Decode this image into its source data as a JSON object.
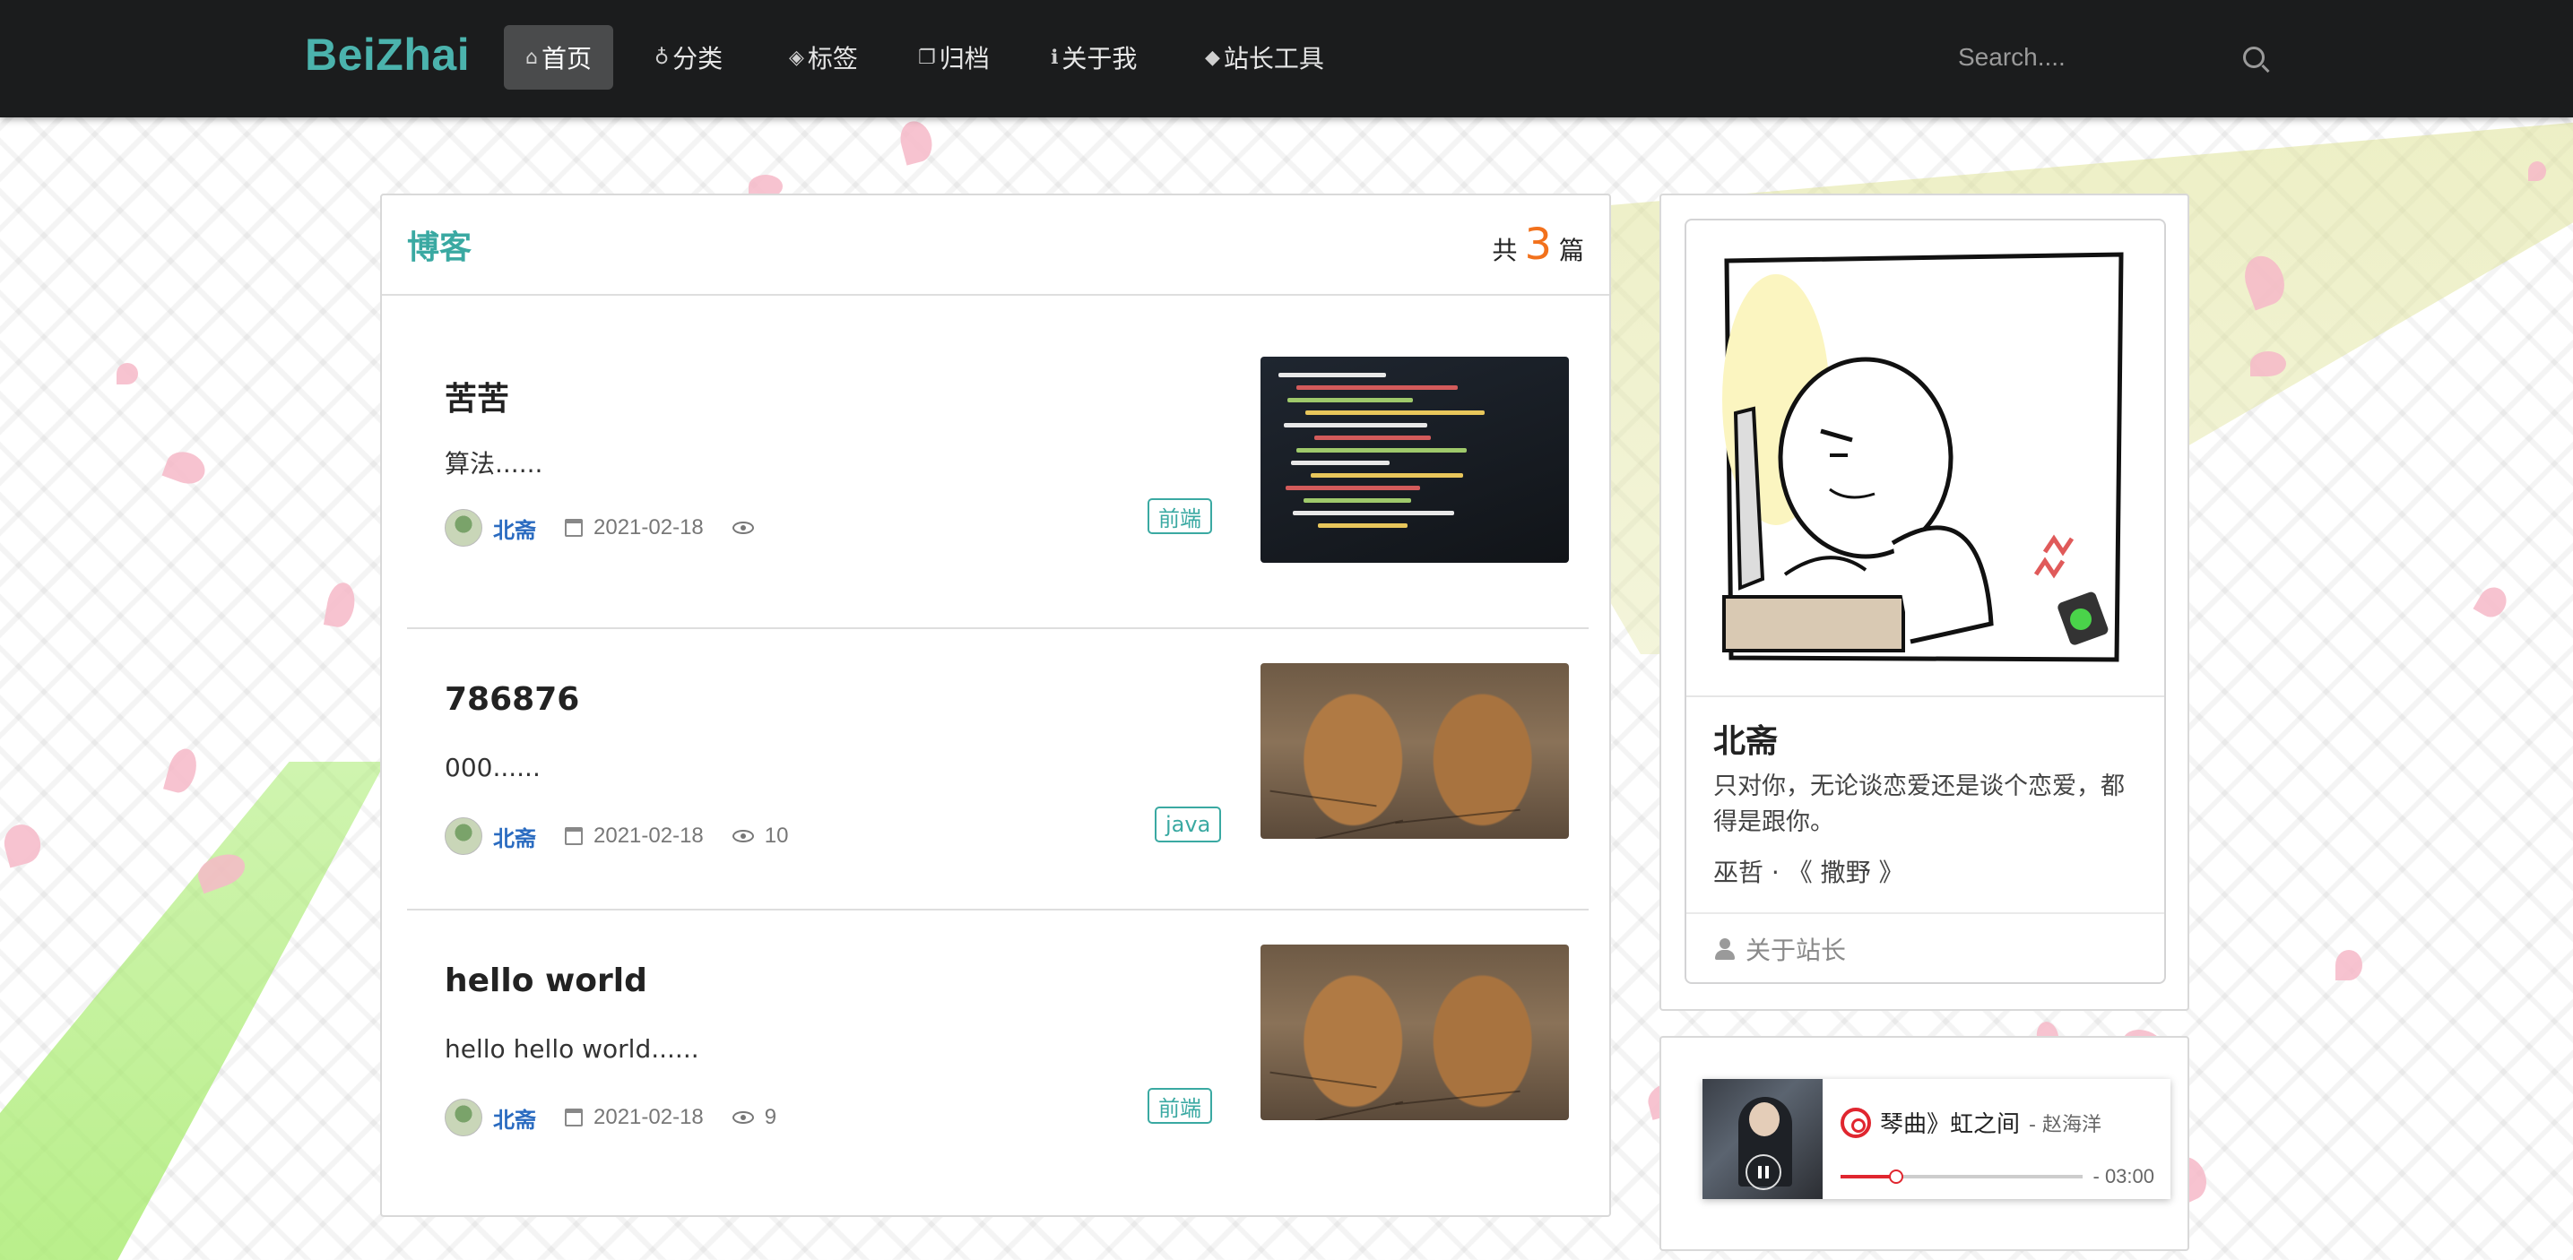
{
  "header": {
    "brand": "BeiZhai",
    "nav": [
      {
        "label": "首页",
        "icon": "home-icon",
        "active": true
      },
      {
        "label": "分类",
        "icon": "lightbulb-icon",
        "active": false
      },
      {
        "label": "标签",
        "icon": "tags-icon",
        "active": false
      },
      {
        "label": "归档",
        "icon": "clone-icon",
        "active": false
      },
      {
        "label": "关于我",
        "icon": "info-icon",
        "active": false
      },
      {
        "label": "站长工具",
        "icon": "tag-icon",
        "active": false
      }
    ],
    "search_placeholder": "Search...."
  },
  "blog": {
    "title": "博客",
    "count_prefix": "共",
    "count": "3",
    "count_suffix": "篇",
    "posts": [
      {
        "title": "苦苦",
        "excerpt": "算法......",
        "author": "北斋",
        "date": "2021-02-18",
        "views": "",
        "tag": "前端",
        "image": "code-screen"
      },
      {
        "title": "786876",
        "excerpt": "000......",
        "author": "北斋",
        "date": "2021-02-18",
        "views": "10",
        "tag": "java",
        "image": "giant-feet"
      },
      {
        "title": "hello world",
        "excerpt": "hello hello world......",
        "author": "北斋",
        "date": "2021-02-18",
        "views": "9",
        "tag": "前端",
        "image": "giant-feet"
      }
    ]
  },
  "profile": {
    "name": "北斋",
    "description": "只对你，无论谈恋爱还是谈个恋爱，都得是跟你。",
    "quote": "巫哲 · 《 撒野 》",
    "about_link": "关于站长"
  },
  "player": {
    "song": "琴曲》虹之间",
    "artist": " - 赵海洋",
    "time": "- 03:00",
    "progress": 0.23
  },
  "colors": {
    "accent": "#3aa9a2",
    "brand": "#4bb3ad",
    "nav_bg": "#1b1c1d",
    "count": "#f2711c",
    "author": "#2a6bc0",
    "player_red": "#e0262f"
  }
}
